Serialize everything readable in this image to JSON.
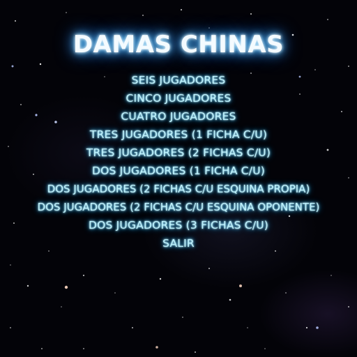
{
  "title": "DAMAS CHINAS",
  "menu": {
    "items": [
      {
        "label": "SEIS JUGADORES"
      },
      {
        "label": "CINCO JUGADORES"
      },
      {
        "label": "CUATRO JUGADORES"
      },
      {
        "label": "TRES JUGADORES (1 FICHA C/U)"
      },
      {
        "label": "TRES JUGADORES (2 FICHAS C/U)"
      },
      {
        "label": "DOS JUGADORES (1 FICHA C/U)"
      },
      {
        "label": "DOS JUGADORES (2 FICHAS C/U ESQUINA PROPIA)"
      },
      {
        "label": "DOS JUGADORES (2 FICHAS C/U ESQUINA OPONENTE)"
      },
      {
        "label": "DOS JUGADORES (3 FICHAS C/U)"
      },
      {
        "label": "SALIR"
      }
    ]
  },
  "colors": {
    "background": "#030308",
    "title_glow": "#3aa8ff",
    "menu_text": "#b9f3ff",
    "menu_glow": "#1aa0ff"
  }
}
